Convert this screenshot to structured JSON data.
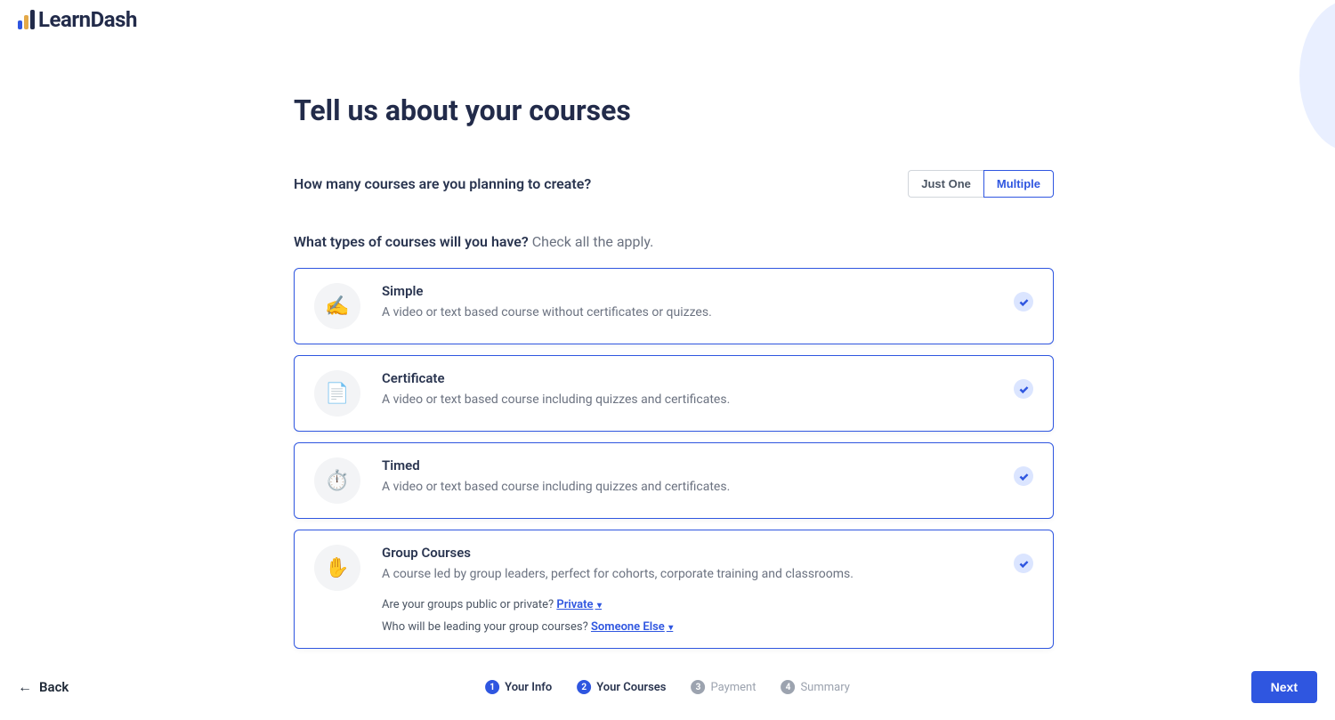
{
  "brand": "LearnDash",
  "page": {
    "title": "Tell us about your courses"
  },
  "q1": {
    "label": "How many courses are you planning to create?",
    "options": {
      "justOne": "Just One",
      "multiple": "Multiple"
    },
    "selected": "multiple"
  },
  "q2": {
    "bold": "What types of courses will you have?",
    "light": " Check all the apply."
  },
  "cards": {
    "simple": {
      "icon": "✍️",
      "title": "Simple",
      "desc": "A video or text based course without certificates or quizzes."
    },
    "certificate": {
      "icon": "📄",
      "title": "Certificate",
      "desc": "A video or text based course including quizzes and certificates."
    },
    "timed": {
      "icon": "⏱️",
      "title": "Timed",
      "desc": "A video or text based course including quizzes and certificates."
    },
    "group": {
      "icon": "✋",
      "title": "Group Courses",
      "desc": "A course led by group leaders, perfect for cohorts, corporate training and classrooms.",
      "sub1_q": "Are your groups public or private? ",
      "sub1_a": "Private",
      "sub2_q": "Who will be leading your group courses? ",
      "sub2_a": "Someone Else"
    }
  },
  "footer": {
    "back": "Back",
    "next": "Next",
    "steps": {
      "s1": "Your Info",
      "s2": "Your Courses",
      "s3": "Payment",
      "s4": "Summary"
    }
  }
}
